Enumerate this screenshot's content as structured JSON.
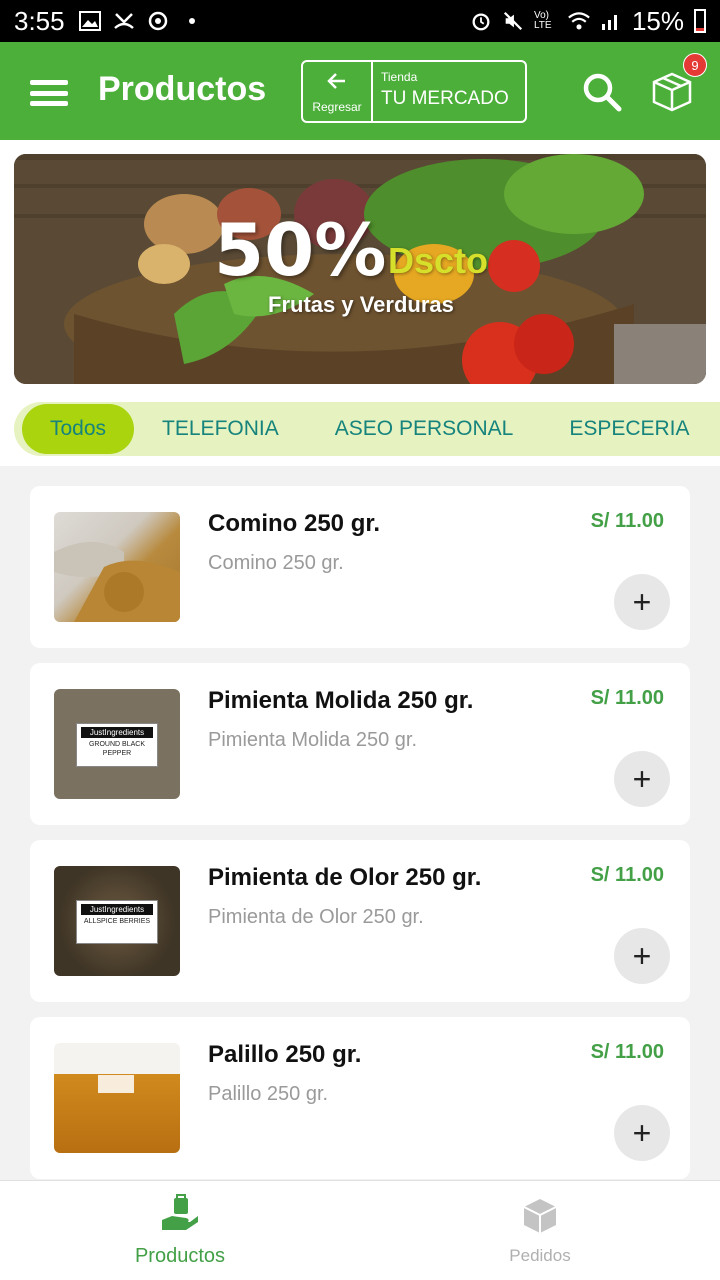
{
  "status_bar": {
    "time": "3:55",
    "battery_percent": "15%",
    "lte_label": "Vo) LTE"
  },
  "app_bar": {
    "title": "Productos",
    "back_label": "Regresar",
    "store_label": "Tienda",
    "store_name": "TU MERCADO",
    "cart_badge": "9"
  },
  "banner": {
    "percent": "50%",
    "discount_word": "Dscto",
    "subtitle": "Frutas y Verduras"
  },
  "categories": [
    {
      "label": "Todos",
      "active": true
    },
    {
      "label": "TELEFONIA",
      "active": false
    },
    {
      "label": "ASEO PERSONAL",
      "active": false
    },
    {
      "label": "ESPECERIA",
      "active": false
    }
  ],
  "products": [
    {
      "name": "Comino 250 gr.",
      "description": "Comino 250 gr.",
      "price": "S/ 11.00"
    },
    {
      "name": "Pimienta Molida 250 gr.",
      "description": "Pimienta Molida 250 gr.",
      "price": "S/ 11.00",
      "thumb_brand": "JustIngredients",
      "thumb_text": "GROUND BLACK PEPPER"
    },
    {
      "name": "Pimienta de Olor 250 gr.",
      "description": "Pimienta de Olor 250 gr.",
      "price": "S/ 11.00",
      "thumb_brand": "JustIngredients",
      "thumb_text": "ALLSPICE BERRIES"
    },
    {
      "name": "Palillo 250 gr.",
      "description": "Palillo 250 gr.",
      "price": "S/ 11.00"
    }
  ],
  "add_symbol": "+",
  "bottom_nav": {
    "products_label": "Productos",
    "orders_label": "Pedidos"
  },
  "colors": {
    "primary": "#4caf3a",
    "price": "#43a047",
    "category_bg": "#e6f2bf",
    "category_active": "#a9d40e",
    "category_text": "#16847d",
    "badge": "#e53935"
  }
}
